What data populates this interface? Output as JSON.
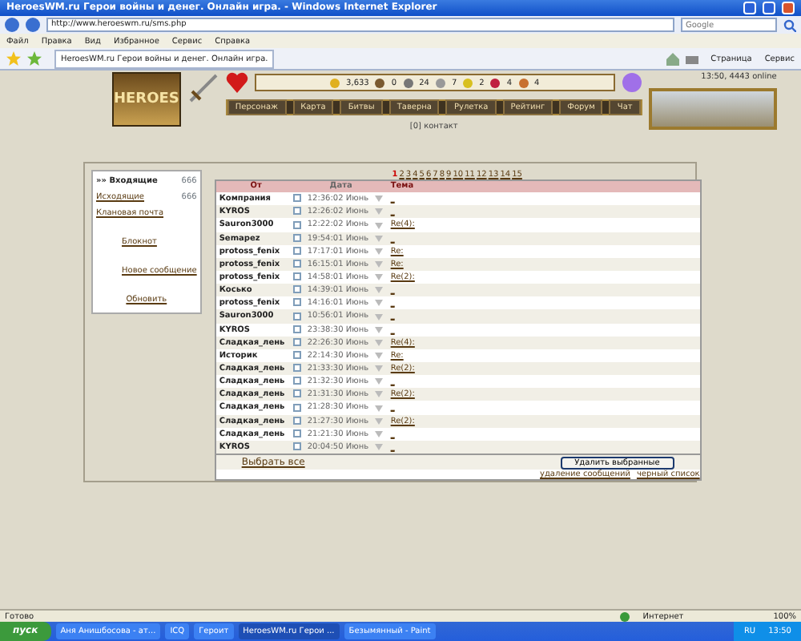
{
  "window": {
    "title": "HeroesWM.ru Герои войны и денег. Онлайн игра. - Windows Internet Explorer"
  },
  "browser": {
    "url": "http://www.heroeswm.ru/sms.php",
    "search_placeholder": "Google",
    "menu": [
      "Файл",
      "Правка",
      "Вид",
      "Избранное",
      "Сервис",
      "Справка"
    ],
    "tab": "HeroesWM.ru Герои войны и денег. Онлайн игра.",
    "toolbar_buttons": [
      "Страница",
      "Сервис"
    ]
  },
  "game_header": {
    "logo": "HEROES",
    "resources": [
      "3,633",
      "0",
      "24",
      "7",
      "2",
      "4",
      "4"
    ],
    "server_info": "13:50, 4443 online",
    "nav": [
      "Персонаж",
      "Карта",
      "Битвы",
      "Таверна",
      "Рулетка",
      "Рейтинг",
      "Форум",
      "Чат"
    ],
    "contacts": "[0] контакт"
  },
  "mail_sidebar": {
    "folders": [
      {
        "label": "»» Входящие",
        "count": "666",
        "selected": true
      },
      {
        "label": "Исходящие",
        "count": "666",
        "selected": false
      },
      {
        "label": "Клановая почта",
        "selected": false
      }
    ],
    "links": [
      "Блокнот",
      "Новое сообщение",
      "Обновить"
    ]
  },
  "pagination": {
    "pages": [
      {
        "label": "1",
        "selected": true
      },
      {
        "label": "2",
        "selected": false
      },
      {
        "label": "3",
        "selected": false
      },
      {
        "label": "4",
        "selected": false
      },
      {
        "label": "5",
        "selected": false
      },
      {
        "label": "6",
        "selected": false
      },
      {
        "label": "7",
        "selected": false
      },
      {
        "label": "8",
        "selected": false
      },
      {
        "label": "9",
        "selected": false
      },
      {
        "label": "10",
        "selected": false
      },
      {
        "label": "11",
        "selected": false
      },
      {
        "label": "12",
        "selected": false
      },
      {
        "label": "13",
        "selected": false
      },
      {
        "label": "14",
        "selected": false
      },
      {
        "label": "15",
        "selected": false
      }
    ]
  },
  "messages": {
    "columns": [
      "От",
      "Дата",
      "Тема"
    ],
    "rows": [
      {
        "from": "Компрания",
        "checked": false,
        "date": "12:36:02 Июнь",
        "subject": "_"
      },
      {
        "from": "KYROS",
        "checked": false,
        "date": "12:26:02 Июнь",
        "subject": "_"
      },
      {
        "from": "Sauron3000",
        "checked": false,
        "date": "12:22:02 Июнь",
        "subject": "Re(4):"
      },
      {
        "from": "Semapez",
        "checked": false,
        "date": "19:54:01 Июнь",
        "subject": "_"
      },
      {
        "from": "protoss_fenix",
        "checked": false,
        "date": "17:17:01 Июнь",
        "subject": "Re:"
      },
      {
        "from": "protoss_fenix",
        "checked": false,
        "date": "16:15:01 Июнь",
        "subject": "Re:"
      },
      {
        "from": "protoss_fenix",
        "checked": false,
        "date": "14:58:01 Июнь",
        "subject": "Re(2):"
      },
      {
        "from": "Косько",
        "checked": false,
        "date": "14:39:01 Июнь",
        "subject": "_"
      },
      {
        "from": "protoss_fenix",
        "checked": false,
        "date": "14:16:01 Июнь",
        "subject": "_"
      },
      {
        "from": "Sauron3000",
        "checked": false,
        "date": "10:56:01 Июнь",
        "subject": "_"
      },
      {
        "from": "KYROS",
        "checked": false,
        "date": "23:38:30 Июнь",
        "subject": "_"
      },
      {
        "from": "Сладкая_лень",
        "checked": false,
        "date": "22:26:30 Июнь",
        "subject": "Re(4):"
      },
      {
        "from": "Историк",
        "checked": false,
        "date": "22:14:30 Июнь",
        "subject": "Re:"
      },
      {
        "from": "Сладкая_лень",
        "checked": false,
        "date": "21:33:30 Июнь",
        "subject": "Re(2):"
      },
      {
        "from": "Сладкая_лень",
        "checked": false,
        "date": "21:32:30 Июнь",
        "subject": "_"
      },
      {
        "from": "Сладкая_лень",
        "checked": false,
        "date": "21:31:30 Июнь",
        "subject": "Re(2):"
      },
      {
        "from": "Сладкая_лень",
        "checked": false,
        "date": "21:28:30 Июнь",
        "subject": "_"
      },
      {
        "from": "Сладкая_лень",
        "checked": false,
        "date": "21:27:30 Июнь",
        "subject": "Re(2):"
      },
      {
        "from": "Сладкая_лень",
        "checked": false,
        "date": "21:21:30 Июнь",
        "subject": "_"
      },
      {
        "from": "KYROS",
        "checked": false,
        "date": "20:04:50 Июнь",
        "subject": "_"
      }
    ]
  },
  "footer": {
    "select_all": "Выбрать все",
    "delete_button": "Удалить выбранные",
    "links": [
      "удаление сообщений",
      "черный список"
    ]
  },
  "status_bar": {
    "text": "Готово",
    "zone": "Интернет",
    "zoom": "100%"
  },
  "taskbar": {
    "start": "пуск",
    "items": [
      {
        "label": "Аня Анишбосова - ат...",
        "selected": false
      },
      {
        "label": "ICQ",
        "selected": false
      },
      {
        "label": "Героит",
        "selected": false
      },
      {
        "label": "HeroesWM.ru Герои ...",
        "selected": true
      },
      {
        "label": "Безымянный - Paint",
        "selected": false
      }
    ],
    "language": "RU",
    "clock": "13:50"
  }
}
